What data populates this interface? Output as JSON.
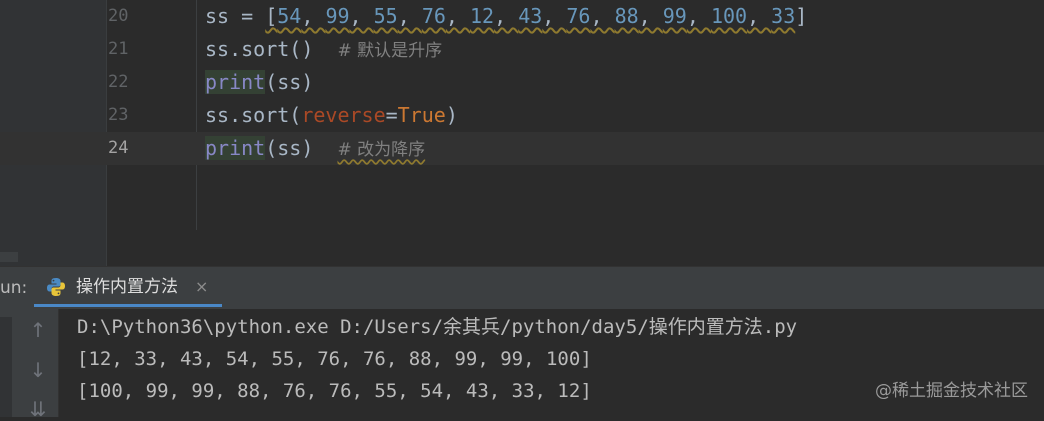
{
  "editor": {
    "lines": [
      {
        "number": "20",
        "seg": {
          "var": "ss",
          "eq": " = ",
          "open": "[",
          "close": "]",
          "nums": [
            "54",
            "99",
            "55",
            "76",
            "12",
            "43",
            "76",
            "88",
            "99",
            "100",
            "33"
          ],
          "sep": ", "
        }
      },
      {
        "number": "21",
        "seg": {
          "code": "ss.sort()",
          "comment": "# 默认是升序"
        }
      },
      {
        "number": "22",
        "seg": {
          "fn": "print",
          "args": "(ss)"
        }
      },
      {
        "number": "23",
        "seg": {
          "pre": "ss.sort(",
          "param": "reverse",
          "eq": "=",
          "val": "True",
          "post": ")"
        }
      },
      {
        "number": "24",
        "seg": {
          "fn": "print",
          "args": "(ss)",
          "comment": "# 改为降序"
        }
      }
    ]
  },
  "run_panel": {
    "label": "un:",
    "tab_title": "操作内置方法",
    "close_glyph": "×",
    "toolbar_up": "↑",
    "toolbar_down": "↓",
    "toolbar_wrap": "⇊"
  },
  "console": {
    "lines": [
      "D:\\Python36\\python.exe D:/Users/余其兵/python/day5/操作内置方法.py",
      "[12, 33, 43, 54, 55, 76, 76, 88, 99, 99, 100]",
      "[100, 99, 99, 88, 76, 76, 55, 54, 43, 33, 12]"
    ]
  },
  "watermark": "@稀土掘金技术社区",
  "colors": {
    "background": "#2b2b2b",
    "number": "#6897bb",
    "keyword": "#cc7832",
    "builtin": "#8888c6",
    "comment": "#808080",
    "tab_underline": "#4a88c7"
  }
}
